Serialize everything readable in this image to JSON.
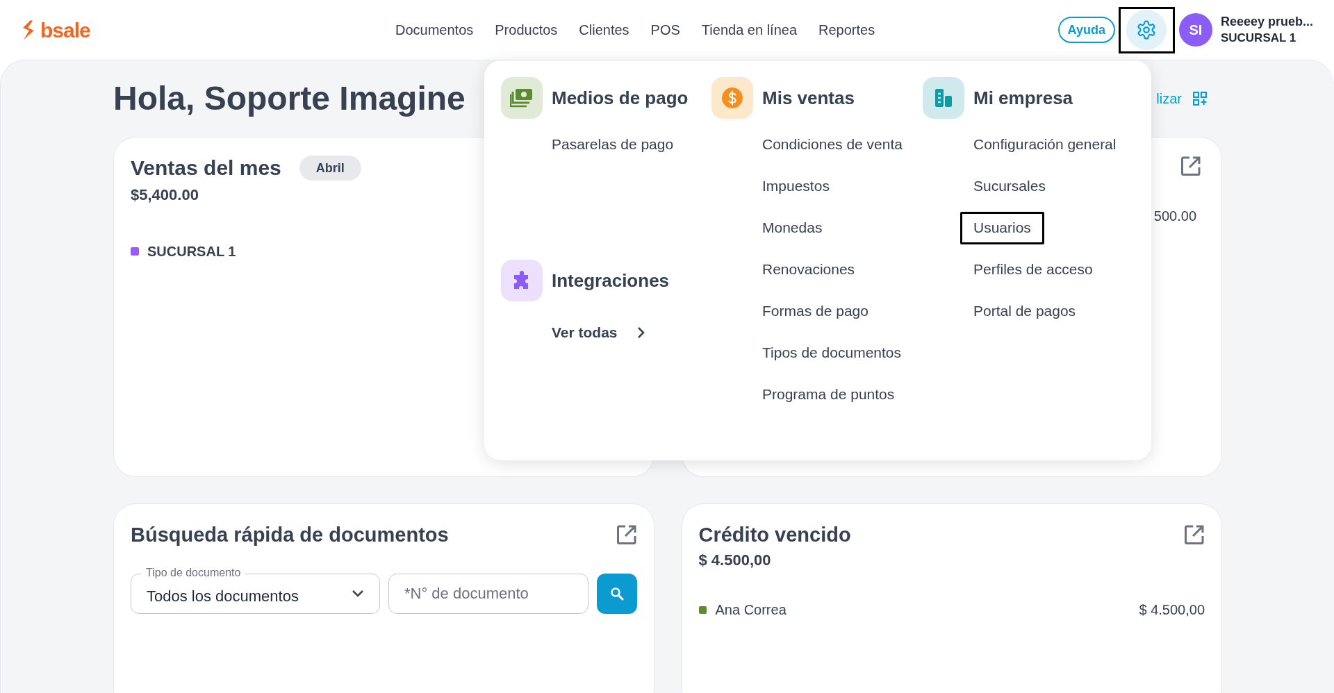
{
  "header": {
    "logo": "bsale",
    "nav": [
      "Documentos",
      "Productos",
      "Clientes",
      "POS",
      "Tienda en línea",
      "Reportes"
    ],
    "help_button": "Ayuda",
    "settings_button": {
      "expanded": true,
      "highlighted": true
    },
    "user": {
      "initials": "SI",
      "name": "Reeeey prueb...",
      "branch": "SUCURSAL 1"
    }
  },
  "greeting": "Hola, Soporte Imagine",
  "customize_link": "lizar",
  "cards": [
    {
      "kind": "sales",
      "title": "Ventas del mes",
      "badge": "Abril",
      "total": "$5,400.00",
      "legend": [
        {
          "label": "SUCURSAL 1",
          "color": "#9b5cf6"
        }
      ]
    },
    {
      "kind": "partial",
      "value": "500.00",
      "open_icon": true
    },
    {
      "kind": "search",
      "title": "Búsqueda rápida de documentos",
      "select": {
        "label": "Tipo de documento",
        "value": "Todos los documentos"
      },
      "number_field": {
        "placeholder": "*N° de documento"
      },
      "open_icon": true
    },
    {
      "kind": "credit",
      "title": "Crédito vencido",
      "total": "$ 4.500,00",
      "rows": [
        {
          "name": "Ana Correa",
          "amount": "$ 4.500,00",
          "color": "#5b8c32"
        }
      ],
      "open_icon": true
    }
  ],
  "settings_menu": {
    "columns": [
      [
        {
          "kind": "payments",
          "title": "Medios de pago",
          "items": [
            {
              "label": "Pasarelas de pago",
              "highlighted": false
            }
          ]
        },
        {
          "kind": "integrations",
          "title": "Integraciones",
          "link": "Ver todas"
        }
      ],
      [
        {
          "kind": "sales",
          "title": "Mis ventas",
          "items": [
            {
              "label": "Condiciones de venta",
              "highlighted": false
            },
            {
              "label": "Impuestos",
              "highlighted": false
            },
            {
              "label": "Monedas",
              "highlighted": false
            },
            {
              "label": "Renovaciones",
              "highlighted": false
            },
            {
              "label": "Formas de pago",
              "highlighted": false
            },
            {
              "label": "Tipos de documentos",
              "highlighted": false
            },
            {
              "label": "Programa de puntos",
              "highlighted": false
            }
          ]
        }
      ],
      [
        {
          "kind": "company",
          "title": "Mi empresa",
          "items": [
            {
              "label": "Configuración general",
              "highlighted": false
            },
            {
              "label": "Sucursales",
              "highlighted": false
            },
            {
              "label": "Usuarios",
              "highlighted": true
            },
            {
              "label": "Perfiles de acceso",
              "highlighted": false
            },
            {
              "label": "Portal de pagos",
              "highlighted": false
            }
          ]
        }
      ]
    ]
  }
}
